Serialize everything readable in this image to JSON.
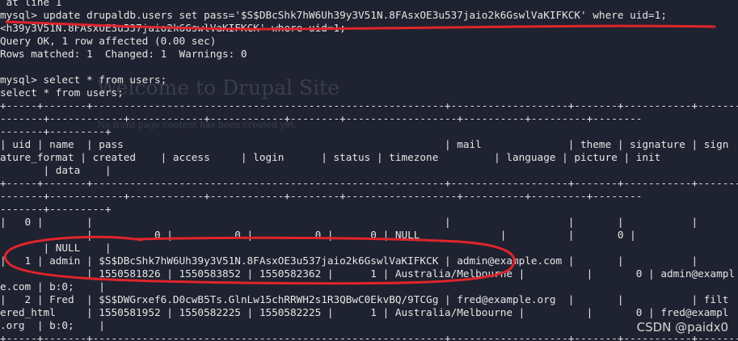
{
  "background_page": {
    "title": "Welcome to Drupal Site",
    "subtitle": "No front page content has been created yet."
  },
  "terminal": {
    "lines": [
      " at line 1",
      "mysql> update drupaldb.users set pass='$S$DBcShk7hW6Uh39y3V51N.8FAsxOE3u537jaio2k6GswlVaKIFKCK' where uid=1;",
      "<h39y3V51N.8FAsxOE3u537jaio2k6GswlVaKIFKCK' where uid=1;",
      "Query OK, 1 row affected (0.00 sec)",
      "Rows matched: 1  Changed: 1  Warnings: 0",
      "",
      "mysql> select * from users;",
      "select * from users;",
      "+-----+-------+---------------------------------------------------------+-------------------+-------+-----------+------------",
      "-------+------------+------------+------------+--------+------------------+----------+---------+--------",
      "-------+---------+",
      "| uid | name  | pass                                                    | mail              | theme | signature | sign",
      "ature_format | created    | access     | login      | status | timezone         | language | picture | init",
      "       | data    |",
      "+-----+-------+---------------------------------------------------------+-------------------+-------+-----------+------------",
      "-------+------------+------------+------------+--------+------------------+----------+---------+--------",
      "-------+---------+",
      "|   0 |       |                                                         |                   |       |           |",
      "              |          0 |          0 |          0 |      0 | NULL             |          |       0 |",
      "       | NULL    |",
      "|   1 | admin | $S$DBcShk7hW6Uh39y3V51N.8FAsxOE3u537jaio2k6GswlVaKIFKCK | admin@example.com |       |           |",
      "              | 1550581826 | 1550583852 | 1550582362 |      1 | Australia/Melbourne |          |       0 | admin@exampl",
      "e.com | b:0;    |",
      "|   2 | Fred  | $S$DWGrxef6.D0cwB5Ts.GlnLw15chRRWH2s1R3QBwC0EkvBQ/9TCGg | fred@example.org  |       |           | filt",
      "ered_html     | 1550581952 | 1550582225 | 1550582225 |      1 | Australia/Melbourne |          |       0 | fred@exampl",
      ".org  | b:0;    |",
      "+-----+-------+---------------------------------------------------------+-------------------+-------+-----------+------------"
    ]
  },
  "watermark": "CSDN @paidx0",
  "colors": {
    "background": "#1f2230",
    "text": "#e6e6e6",
    "annotation": "#e0242b"
  }
}
